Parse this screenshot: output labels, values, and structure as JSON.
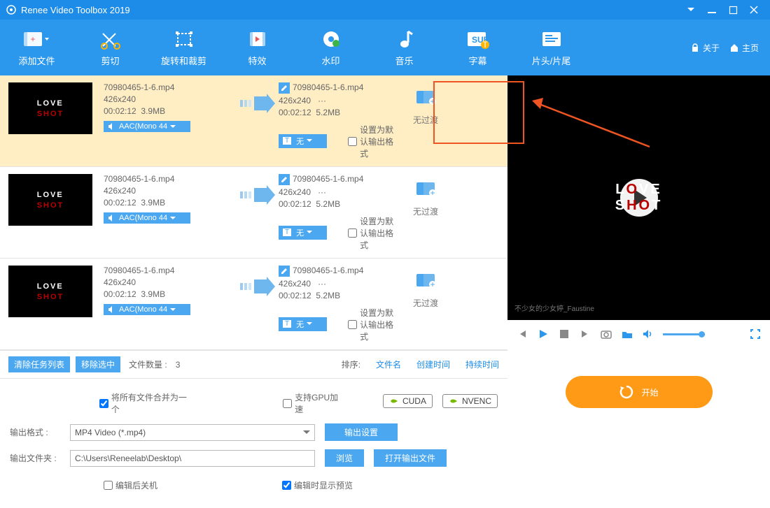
{
  "title": "Renee Video Toolbox 2019",
  "toolbar": {
    "items": [
      "添加文件",
      "剪切",
      "旋转和裁剪",
      "特效",
      "水印",
      "音乐",
      "字幕",
      "片头/片尾"
    ],
    "about": "关于",
    "home": "主页"
  },
  "rows": [
    {
      "src_name": "70980465-1-6.mp4",
      "src_res": "426x240",
      "src_dur": "00:02:12",
      "src_size": "3.9MB",
      "dst_name": "70980465-1-6.mp4",
      "dst_res": "426x240",
      "dst_ext": "···",
      "dst_dur": "00:02:12",
      "dst_size": "5.2MB",
      "audio": "AAC(Mono 44",
      "sub": "无",
      "default_label": "设置为默认输出格式",
      "trans": "无过渡",
      "selected": true
    },
    {
      "src_name": "70980465-1-6.mp4",
      "src_res": "426x240",
      "src_dur": "00:02:12",
      "src_size": "3.9MB",
      "dst_name": "70980465-1-6.mp4",
      "dst_res": "426x240",
      "dst_ext": "···",
      "dst_dur": "00:02:12",
      "dst_size": "5.2MB",
      "audio": "AAC(Mono 44",
      "sub": "无",
      "default_label": "设置为默认输出格式",
      "trans": "无过渡",
      "selected": false
    },
    {
      "src_name": "70980465-1-6.mp4",
      "src_res": "426x240",
      "src_dur": "00:02:12",
      "src_size": "3.9MB",
      "dst_name": "70980465-1-6.mp4",
      "dst_res": "426x240",
      "dst_ext": "···",
      "dst_dur": "00:02:12",
      "dst_size": "5.2MB",
      "audio": "AAC(Mono 44",
      "sub": "无",
      "default_label": "设置为默认输出格式",
      "trans": "无过渡",
      "selected": false
    }
  ],
  "footer": {
    "clear": "清除任务列表",
    "remove": "移除选中",
    "count_label": "文件数量 :",
    "count": "3",
    "sort_label": "排序:",
    "by_name": "文件名",
    "by_ctime": "创建时间",
    "by_dur": "持续时间"
  },
  "opts": {
    "merge": "将所有文件合并为一个",
    "gpu": "支持GPU加速",
    "cuda": "CUDA",
    "nvenc": "NVENC",
    "fmt_label": "输出格式 :",
    "fmt_value": "MP4 Video (*.mp4)",
    "out_settings": "输出设置",
    "dir_label": "输出文件夹 :",
    "dir_value": "C:\\Users\\Reneelab\\Desktop\\",
    "browse": "浏览",
    "open_dir": "打开输出文件",
    "shutdown": "编辑后关机",
    "preview": "编辑时显示预览",
    "start": "开始"
  },
  "preview": {
    "stamp": "不少女的少女婷_Faustine"
  }
}
